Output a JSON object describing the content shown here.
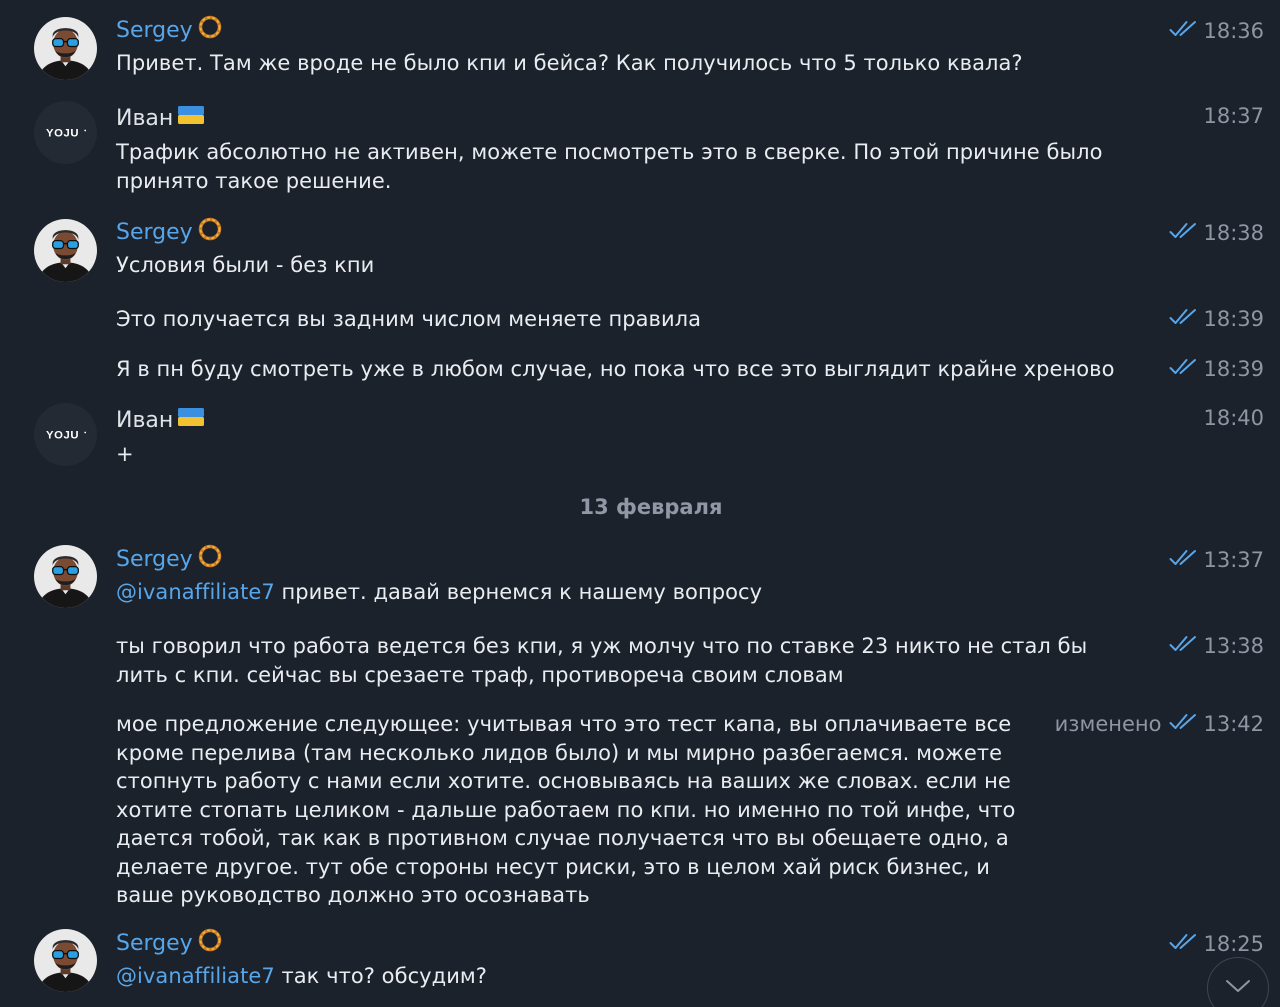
{
  "colors": {
    "background": "#1c222c",
    "sender_accent": "#58a6ea",
    "time_gray": "#8d96a2",
    "check_blue": "#58a6ea"
  },
  "date_separator": "13 февраля",
  "messages": [
    {
      "sender": "Sergey",
      "emoji_icon": "orange-ring-icon",
      "time": "18:36",
      "read_icon": "double-check-icon",
      "text": "Привет. Там же вроде не было кпи и бейса? Как получилось что 5 только квала?"
    },
    {
      "sender": "Иван",
      "emoji_icon": "ukraine-flag-icon",
      "time": "18:37",
      "text": "Трафик абсолютно не активен, можете посмотреть это в сверке. По этой причине было\nпринято такое решение."
    },
    {
      "sender": "Sergey",
      "emoji_icon": "orange-ring-icon",
      "time": "18:38",
      "read_icon": "double-check-icon",
      "text": "Условия были - без кпи"
    },
    {
      "time": "18:39",
      "read_icon": "double-check-icon",
      "text": "Это получается вы задним числом меняете правила"
    },
    {
      "time": "18:39",
      "read_icon": "double-check-icon",
      "text": "Я в пн буду смотреть уже в любом случае, но пока что все это выглядит крайне хреново"
    },
    {
      "sender": "Иван",
      "emoji_icon": "ukraine-flag-icon",
      "time": "18:40",
      "text": "+"
    },
    {
      "sender": "Sergey",
      "emoji_icon": "orange-ring-icon",
      "time": "13:37",
      "read_icon": "double-check-icon",
      "mention": "@ivanaffiliate7",
      "text": " привет. давай вернемся к нашему вопросу"
    },
    {
      "time": "13:38",
      "read_icon": "double-check-icon",
      "text": "ты говорил что работа ведется без кпи, я уж молчу что по ставке 23 никто не стал бы\nлить с кпи. сейчас вы срезаете траф, противореча своим словам"
    },
    {
      "time": "13:42",
      "edited": "изменено",
      "read_icon": "double-check-icon",
      "text": "мое предложение следующее: учитывая что это тест капа, вы оплачиваете все\nкроме перелива (там несколько лидов было) и мы мирно разбегаемся. можете\nстопнуть работу с нами если хотите. основываясь на ваших же словах. если не\nхотите стопать целиком - дальше работаем по кпи. но именно по той инфе, что\nдается тобой, так как в противном случае получается что вы обещаете одно, а\nделаете другое. тут обе стороны несут риски, это в целом хай риск бизнес, и\nваше руководство должно это осознавать"
    },
    {
      "sender": "Sergey",
      "emoji_icon": "orange-ring-icon",
      "time": "18:25",
      "read_icon": "double-check-icon",
      "mention": "@ivanaffiliate7",
      "text": " так что? обсудим?"
    }
  ],
  "avatars": {
    "sergey": {
      "icon": "sergey-avatar-icon"
    },
    "ivan": {
      "icon": "yoju-logo-avatar-icon",
      "logo_text": "YOJU"
    }
  },
  "scroll_button": {
    "icon": "chevron-down-icon"
  }
}
